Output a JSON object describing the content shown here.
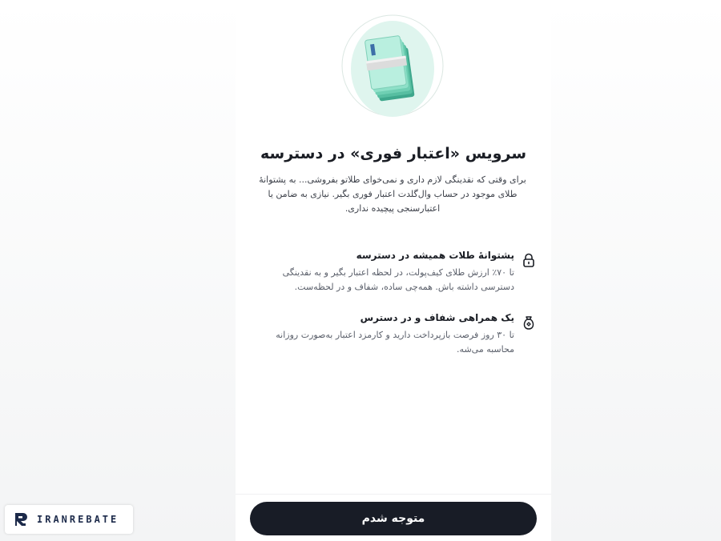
{
  "modal": {
    "title": "سرویس «اعتبار فوری» در دسترسه",
    "description": "برای وقتی که نقدینگی لازم داری و نمی‌خوای طلاتو بفروشی... به پشتوانهٔ طلای موجود در حساب وال‌گلدت اعتبار فوری بگیر. نیازی به ضامن یا اعتبارسنجی پیچیده نداری.",
    "features": [
      {
        "icon": "lock-icon",
        "title": "پشتوانهٔ طلات همیشه در دسترسه",
        "body": "تا ۷۰٪ ارزش طلای کیف‌پولت، در لحظه اعتبار بگیر و به نقدینگی دسترسی داشته باش. همه‌چی ساده، شفاف و در لحظه‌ست."
      },
      {
        "icon": "money-bag-icon",
        "title": "یک همراهی شفاف و در دسترس",
        "body": "تا ۳۰ روز فرصت بازپرداخت دارید و کارمزد اعتبار به‌صورت روزانه محاسبه می‌شه."
      }
    ],
    "confirm_label": "متوجه شدم"
  },
  "brand": {
    "name": "IRANREBATE"
  },
  "colors": {
    "button_bg": "#181c26",
    "hero_circle": "#dff5ee",
    "banknote": "#8ee0c8"
  }
}
